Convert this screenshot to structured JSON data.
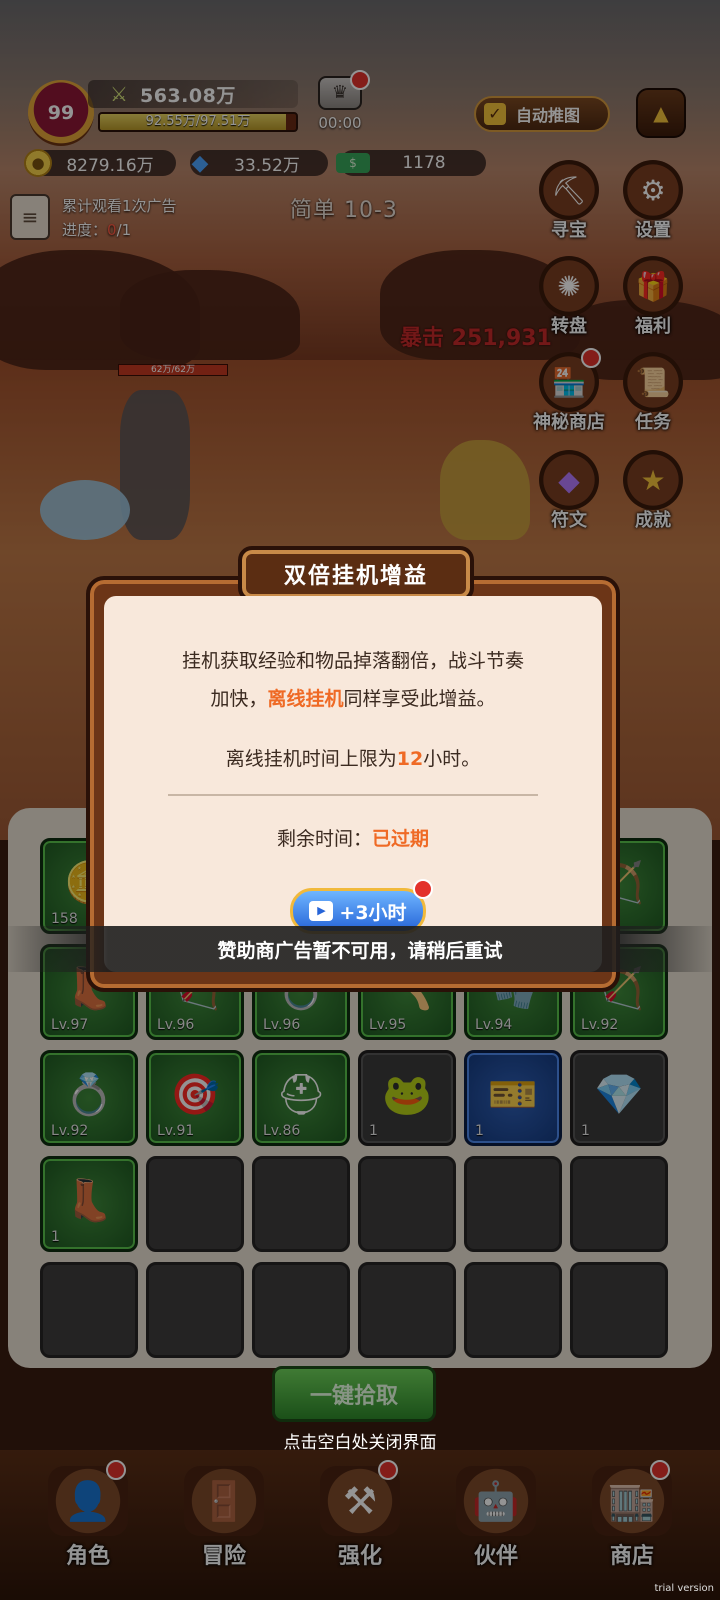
{
  "player": {
    "level": "99",
    "power": "563.08万",
    "exp_text": "92.55万/97.51万",
    "exp_fraction": 0.949
  },
  "vip": {
    "timer": "00:00"
  },
  "auto_btn_label": "自动推图",
  "resources": {
    "gold": "8279.16万",
    "gem": "33.52万",
    "cash": "1178"
  },
  "ad_task": {
    "line1": "累计观看1次广告",
    "progress_label": "进度：",
    "progress_now": "0",
    "progress_total": "/1"
  },
  "stage": "简单 10-3",
  "side_buttons": [
    {
      "label": "寻宝",
      "icon": "pickaxe-icon"
    },
    {
      "label": "设置",
      "icon": "gear-icon"
    },
    {
      "label": "转盘",
      "icon": "wheel-icon"
    },
    {
      "label": "福利",
      "icon": "gift-icon"
    },
    {
      "label": "神秘商店",
      "icon": "shop-stall-icon"
    },
    {
      "label": "任务",
      "icon": "scroll-icon"
    },
    {
      "label": "符文",
      "icon": "crystal-icon"
    },
    {
      "label": "成就",
      "icon": "star-icon"
    }
  ],
  "battle": {
    "crit_text": "暴击 251,931",
    "hp_text": "62万/62万"
  },
  "dialog": {
    "title": "双倍挂机增益",
    "line1": "挂机获取经验和物品掉落翻倍，战斗节奏",
    "line2_pre": "加快，",
    "line2_hl": "离线挂机",
    "line2_post": "同样享受此增益。",
    "line3_pre": "离线挂机时间上限为",
    "line3_hl": "12",
    "line3_post": "小时。",
    "remain_label": "剩余时间：",
    "remain_value": "已过期",
    "ad_button": "+3小时",
    "toast": "赞助商广告暂不可用，请稍后重试"
  },
  "inventory": {
    "rows": [
      [
        {
          "rarity": "green",
          "icon": "coin-icon",
          "level": "158"
        },
        {
          "rarity": "green",
          "icon": "",
          "level": ""
        },
        {
          "rarity": "green",
          "icon": "",
          "level": ""
        },
        {
          "rarity": "green",
          "icon": "",
          "level": ""
        },
        {
          "rarity": "green",
          "icon": "",
          "level": ""
        },
        {
          "rarity": "green",
          "icon": "bow-icon",
          "level": ""
        }
      ],
      [
        {
          "rarity": "green",
          "icon": "boot-icon",
          "level": "Lv.97"
        },
        {
          "rarity": "green",
          "icon": "bow-icon",
          "level": "Lv.96"
        },
        {
          "rarity": "green",
          "icon": "ring-icon",
          "level": "Lv.96"
        },
        {
          "rarity": "green",
          "icon": "axe-icon",
          "level": "Lv.95"
        },
        {
          "rarity": "green",
          "icon": "glove-icon",
          "level": "Lv.94"
        },
        {
          "rarity": "green",
          "icon": "bow-icon",
          "level": "Lv.92"
        }
      ],
      [
        {
          "rarity": "green",
          "icon": "ring-icon",
          "level": "Lv.92"
        },
        {
          "rarity": "green",
          "icon": "quiver-icon",
          "level": "Lv.91"
        },
        {
          "rarity": "green",
          "icon": "helmet-icon",
          "level": "Lv.86"
        },
        {
          "rarity": "dark",
          "icon": "frog-icon",
          "level": "1"
        },
        {
          "rarity": "blue",
          "icon": "ticket-icon",
          "level": "1"
        },
        {
          "rarity": "dark",
          "icon": "gem-icon",
          "level": "1"
        }
      ],
      [
        {
          "rarity": "green",
          "icon": "boot-icon",
          "level": "1"
        },
        {
          "rarity": "empty",
          "icon": "",
          "level": ""
        },
        {
          "rarity": "empty",
          "icon": "",
          "level": ""
        },
        {
          "rarity": "empty",
          "icon": "",
          "level": ""
        },
        {
          "rarity": "empty",
          "icon": "",
          "level": ""
        },
        {
          "rarity": "empty",
          "icon": "",
          "level": ""
        }
      ],
      [
        {
          "rarity": "empty",
          "icon": "",
          "level": ""
        },
        {
          "rarity": "empty",
          "icon": "",
          "level": ""
        },
        {
          "rarity": "empty",
          "icon": "",
          "level": ""
        },
        {
          "rarity": "empty",
          "icon": "",
          "level": ""
        },
        {
          "rarity": "empty",
          "icon": "",
          "level": ""
        },
        {
          "rarity": "empty",
          "icon": "",
          "level": ""
        }
      ]
    ]
  },
  "collect_button": "一键拾取",
  "close_hint": "点击空白处关闭界面",
  "nav": [
    {
      "label": "角色",
      "icon": "character-icon",
      "badge": true
    },
    {
      "label": "冒险",
      "icon": "portal-icon",
      "badge": false
    },
    {
      "label": "强化",
      "icon": "anvil-icon",
      "badge": true
    },
    {
      "label": "伙伴",
      "icon": "partner-icon",
      "badge": false
    },
    {
      "label": "商店",
      "icon": "shop-icon",
      "badge": true
    }
  ],
  "trial": "trial version"
}
